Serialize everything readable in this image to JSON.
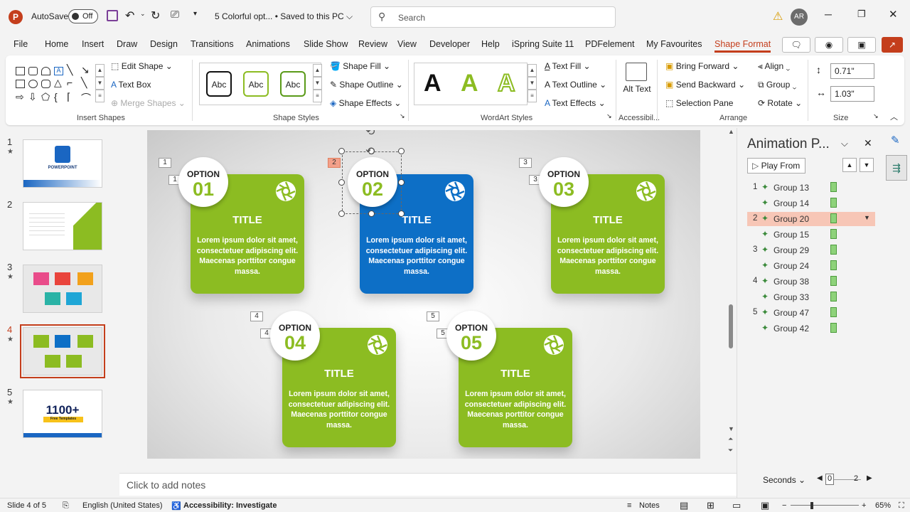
{
  "titlebar": {
    "app_icon": "P",
    "autosave_label": "AutoSave",
    "autosave_state": "Off",
    "doc_title": "5 Colorful opt... • Saved to this PC ⌵",
    "search_placeholder": "Search",
    "avatar_initials": "AR"
  },
  "tabs": [
    "File",
    "Home",
    "Insert",
    "Draw",
    "Design",
    "Transitions",
    "Animations",
    "Slide Show",
    "Review",
    "View",
    "Developer",
    "Help",
    "iSpring Suite 11",
    "PDFelement",
    "My Favourites",
    "Shape Format"
  ],
  "active_tab": "Shape Format",
  "ribbon": {
    "insert_shapes": {
      "label": "Insert Shapes",
      "edit_shape": "Edit Shape ⌄",
      "text_box": "Text Box",
      "merge_shapes": "Merge Shapes ⌄"
    },
    "shape_styles": {
      "label": "Shape Styles",
      "samples": [
        "Abc",
        "Abc",
        "Abc"
      ],
      "fill": "Shape Fill ⌄",
      "outline": "Shape Outline ⌄",
      "effects": "Shape Effects ⌄"
    },
    "wordart": {
      "label": "WordArt Styles",
      "samples": [
        "A",
        "A",
        "A"
      ],
      "text_fill": "Text Fill ⌄",
      "text_outline": "Text Outline ⌄",
      "text_effects": "Text Effects ⌄"
    },
    "accessibility": {
      "label": "Accessibil...",
      "alt_text": "Alt Text"
    },
    "arrange": {
      "label": "Arrange",
      "bring_forward": "Bring Forward",
      "send_backward": "Send Backward",
      "selection_pane": "Selection Pane",
      "align": "Align ⌄",
      "group": "Group ⌄",
      "rotate": "Rotate ⌄"
    },
    "size": {
      "label": "Size",
      "height": "0.71\"",
      "width": "1.03\""
    }
  },
  "thumbnails": [
    {
      "num": "1",
      "star": "★",
      "title": "POWERPOINT"
    },
    {
      "num": "2",
      "star": "",
      "title": ""
    },
    {
      "num": "3",
      "star": "★",
      "title": ""
    },
    {
      "num": "4",
      "star": "★",
      "title": ""
    },
    {
      "num": "5",
      "star": "★",
      "title": "1100+",
      "subtitle": "Free Templates"
    }
  ],
  "slide": {
    "cards": [
      {
        "option": "OPTION",
        "number": "01",
        "title": "TITLE",
        "body": "Lorem ipsum dolor sit amet, consectetuer adipiscing elit. Maecenas porttitor congue massa.",
        "color": "#8cbc22",
        "tag": "1"
      },
      {
        "option": "OPTION",
        "number": "02",
        "title": "TITLE",
        "body": "Lorem ipsum dolor sit amet, consectetuer adipiscing elit. Maecenas porttitor congue massa.",
        "color": "#0d6fc6",
        "tag": "2"
      },
      {
        "option": "OPTION",
        "number": "03",
        "title": "TITLE",
        "body": "Lorem ipsum dolor sit amet, consectetuer adipiscing elit. Maecenas porttitor congue massa.",
        "color": "#8cbc22",
        "tag": "3"
      },
      {
        "option": "OPTION",
        "number": "04",
        "title": "TITLE",
        "body": "Lorem ipsum dolor sit amet, consectetuer adipiscing elit. Maecenas porttitor congue massa.",
        "color": "#8cbc22",
        "tag": "4"
      },
      {
        "option": "OPTION",
        "number": "05",
        "title": "TITLE",
        "body": "Lorem ipsum dolor sit amet, consectetuer adipiscing elit. Maecenas porttitor congue massa.",
        "color": "#8cbc22",
        "tag": "5"
      }
    ]
  },
  "notes_placeholder": "Click to add notes",
  "animation_pane": {
    "title": "Animation P...",
    "play_from": "Play From",
    "items": [
      {
        "num": "1",
        "label": "Group 13",
        "selected": false
      },
      {
        "num": "",
        "label": "Group 14",
        "selected": false
      },
      {
        "num": "2",
        "label": "Group 20",
        "selected": true
      },
      {
        "num": "",
        "label": "Group 15",
        "selected": false
      },
      {
        "num": "3",
        "label": "Group 29",
        "selected": false
      },
      {
        "num": "",
        "label": "Group 24",
        "selected": false
      },
      {
        "num": "4",
        "label": "Group 38",
        "selected": false
      },
      {
        "num": "",
        "label": "Group 33",
        "selected": false
      },
      {
        "num": "5",
        "label": "Group 47",
        "selected": false
      },
      {
        "num": "",
        "label": "Group 42",
        "selected": false
      }
    ],
    "seconds_label": "Seconds ⌄",
    "timeline_start": "0",
    "timeline_end": "2"
  },
  "status": {
    "slide_count": "Slide 4 of 5",
    "language": "English (United States)",
    "accessibility": "Accessibility: Investigate",
    "notes": "Notes",
    "zoom": "65%"
  },
  "colors": {
    "accent": "#c43e1c",
    "green": "#8cbc22",
    "blue": "#0d6fc6"
  }
}
